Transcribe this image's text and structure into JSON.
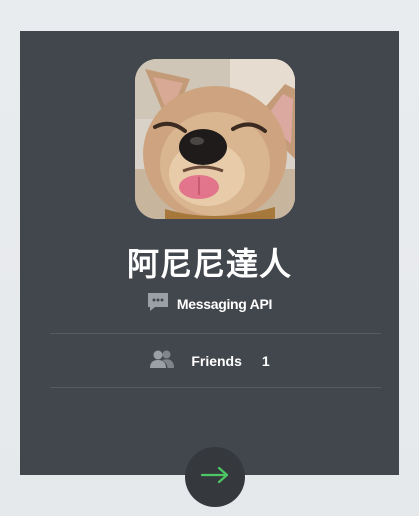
{
  "profile": {
    "name": "阿尼尼達人",
    "avatar": "dog-photo"
  },
  "account_type": {
    "icon": "chat-bubble-icon",
    "label": "Messaging API"
  },
  "friends": {
    "icon": "people-icon",
    "label": "Friends",
    "count": "1"
  },
  "next_button": {
    "icon": "arrow-right-icon"
  },
  "colors": {
    "card_bg": "#42474d",
    "accent_green": "#4cc764"
  }
}
